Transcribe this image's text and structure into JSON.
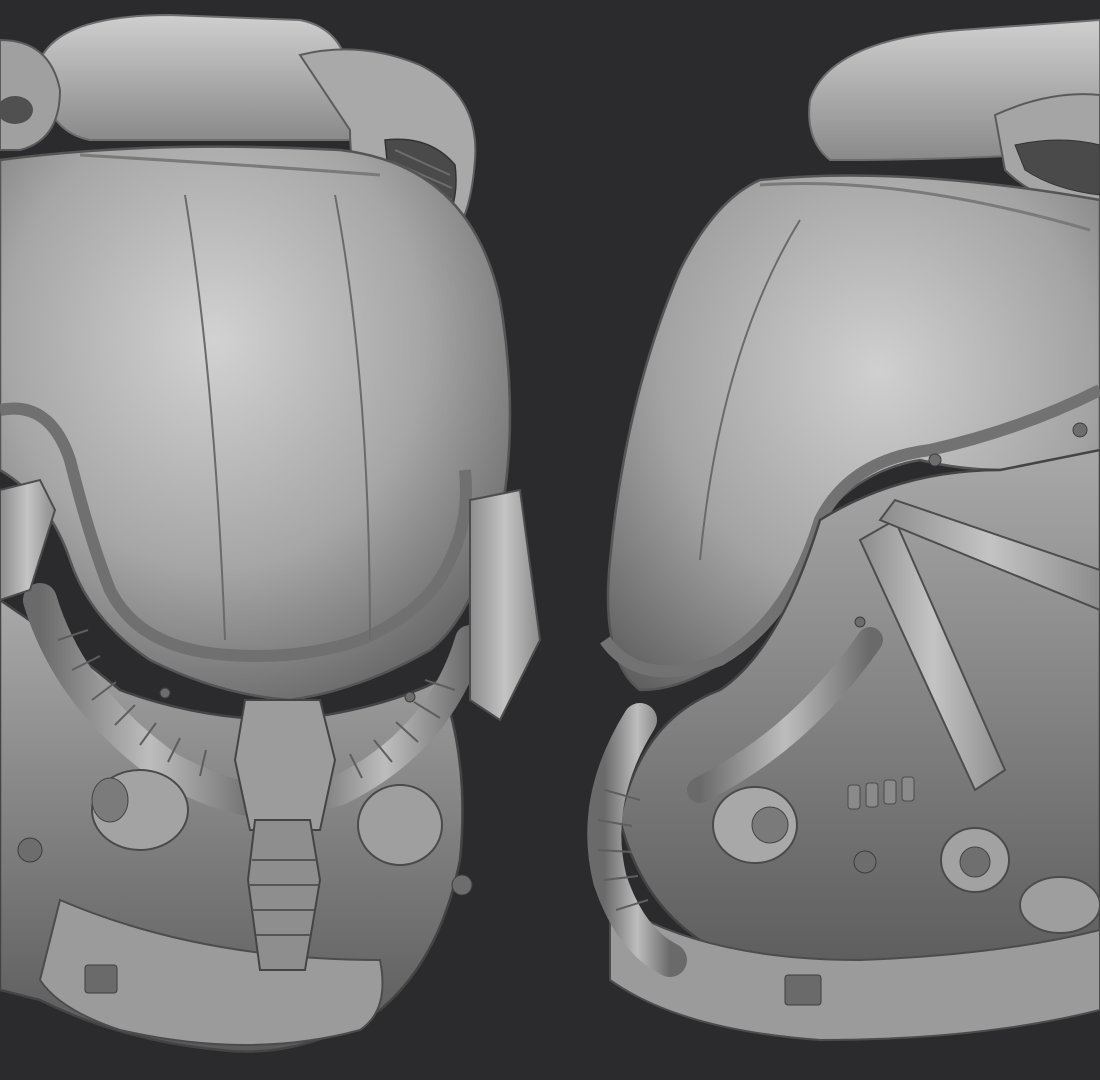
{
  "scene": {
    "subject": "sculpted-pilot-helmet",
    "views": [
      "front-three-quarter",
      "side-profile"
    ],
    "colors": {
      "background": "#2b2b2d",
      "clay_light": "#c9c9c9",
      "clay_mid": "#9a9a9a",
      "clay_dark": "#5a5a5a",
      "clay_shadow": "#3a3a3a",
      "highlight": "#e6e6e6"
    }
  }
}
